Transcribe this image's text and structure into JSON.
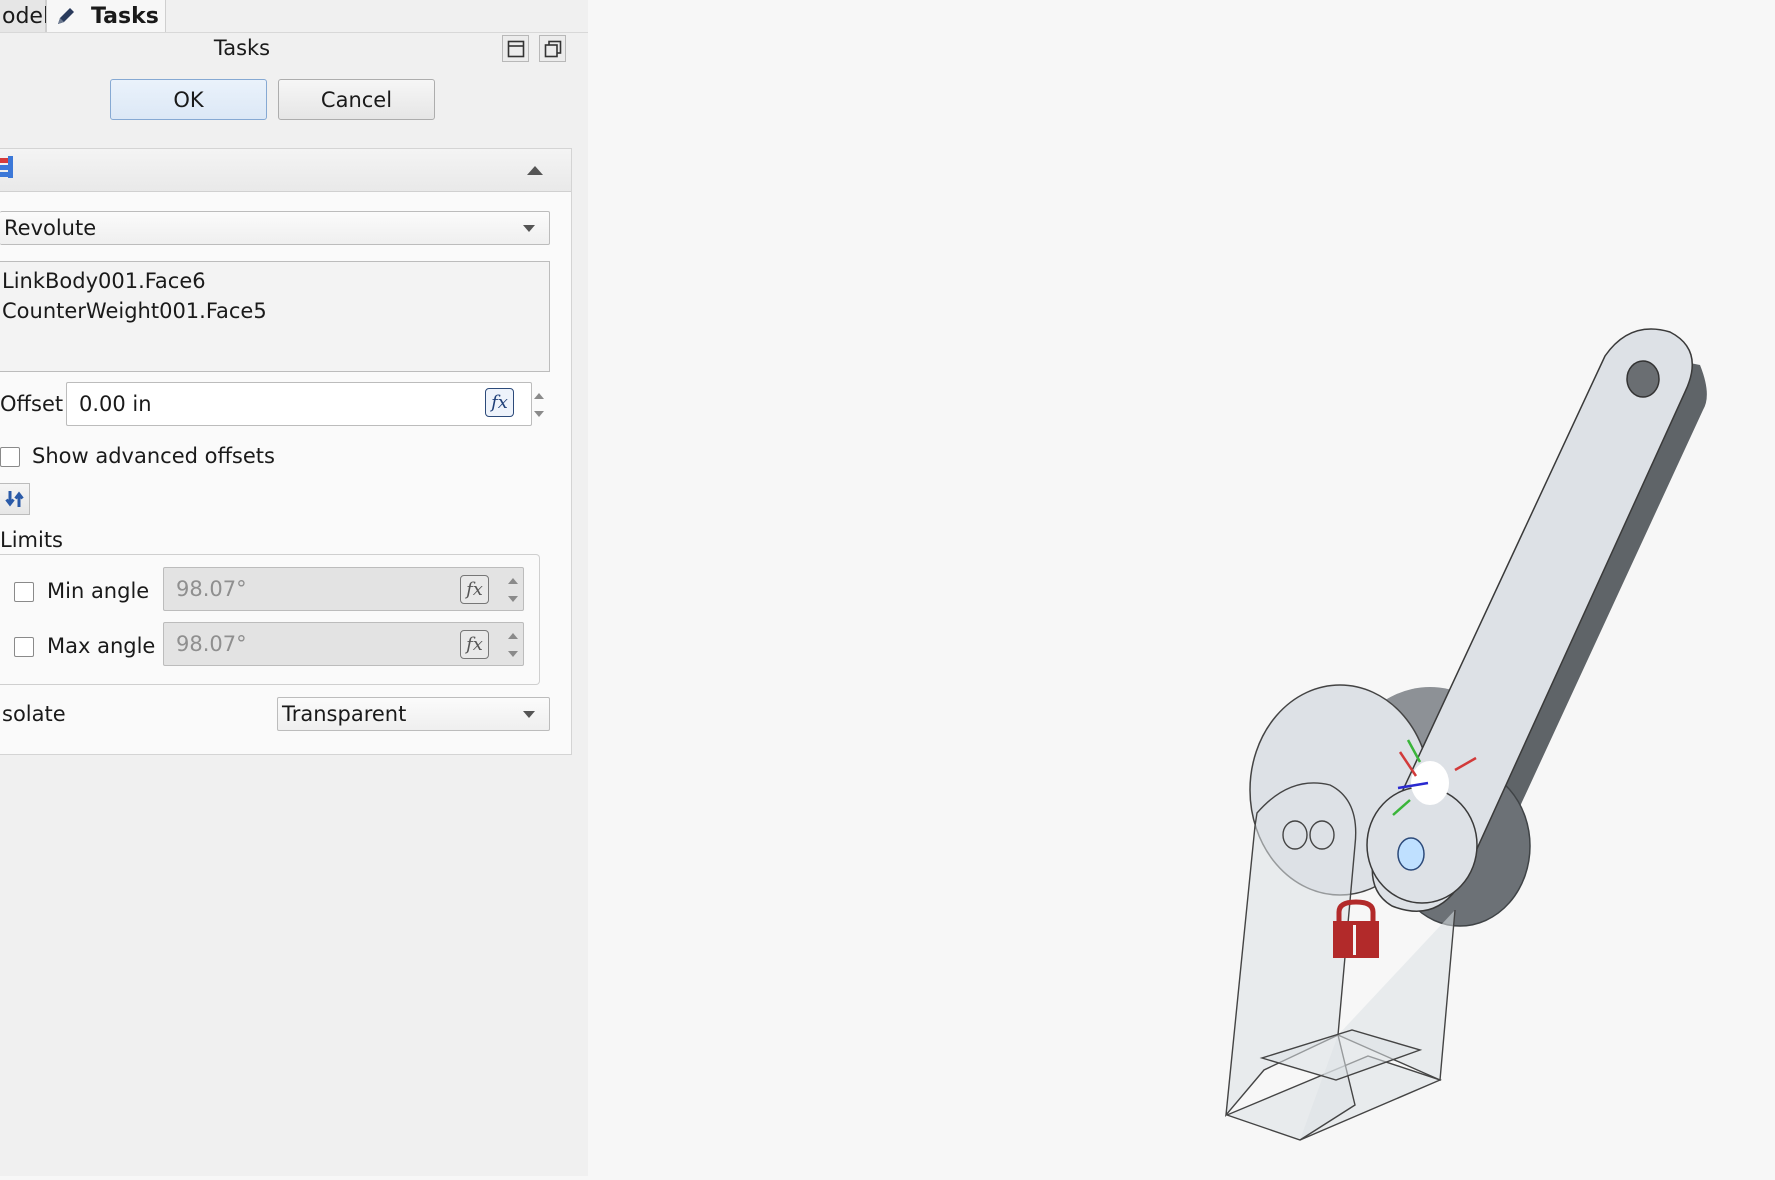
{
  "tabs": {
    "model_label": "odel",
    "tasks_label": "Tasks"
  },
  "tasks": {
    "title": "Tasks",
    "ok_label": "OK",
    "cancel_label": "Cancel"
  },
  "joint": {
    "type_value": "Revolute",
    "references": [
      "LinkBody001.Face6",
      "CounterWeight001.Face5"
    ],
    "offset_label": "Offset",
    "offset_value": "0.00 in",
    "fx_label": "fx",
    "show_advanced_label": "Show advanced offsets",
    "limits_label": "Limits",
    "min_angle_label": "Min angle",
    "min_angle_value": "98.07°",
    "max_angle_label": "Max angle",
    "max_angle_value": "98.07°",
    "isolate_label": "solate",
    "isolate_value": "Transparent"
  },
  "colors": {
    "panel_bg": "#f0f0f0",
    "viewport_bg": "#f7f7f7",
    "part_face": "#dde1e6",
    "part_side": "#5f6468",
    "lock": "#b22a2a",
    "axis_x": "#d23a3a",
    "axis_y": "#3ab53a",
    "axis_z": "#2a2ad0"
  }
}
